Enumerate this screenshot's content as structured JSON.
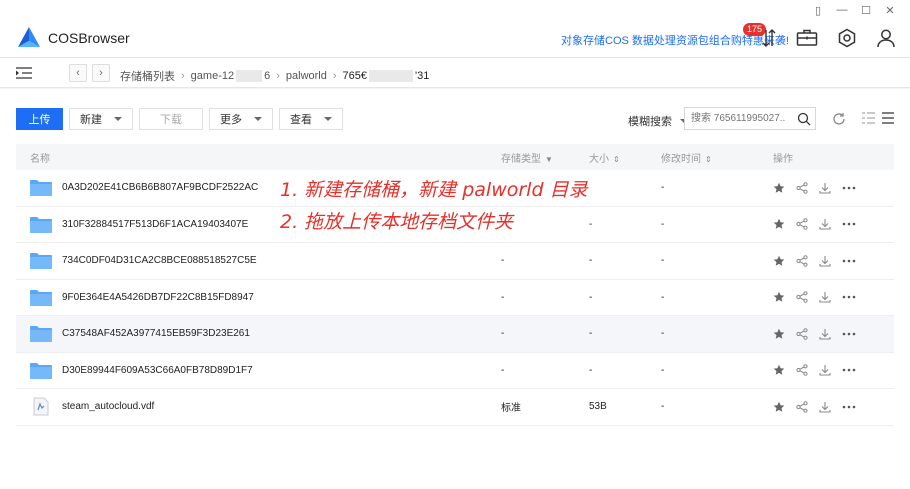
{
  "app": {
    "title": "COSBrowser"
  },
  "promo": {
    "text": "对象存储COS 数据处理资源包组合购特惠来袭!",
    "badge": "175"
  },
  "window_controls": [
    "▯",
    "—",
    "☐",
    "✕"
  ],
  "breadcrumb": {
    "root": "存储桶列表",
    "bucket": "game-12",
    "bucket_tail": "6",
    "folder": "palworld",
    "current": "765€",
    "current_tail": "'31"
  },
  "toolbar": {
    "upload": "上传",
    "new": "新建",
    "download": "下载",
    "more": "更多",
    "view": "查看"
  },
  "search": {
    "mode": "模糊搜索",
    "placeholder": "搜索 765611995027..."
  },
  "columns": {
    "name": "名称",
    "type": "存储类型",
    "size": "大小",
    "modified": "修改时间",
    "ops": "操作"
  },
  "rows": [
    {
      "name": "0A3D202E41CB6B6B807AF9BCDF2522AC",
      "type": "",
      "size": "",
      "modified": "-",
      "kind": "folder"
    },
    {
      "name": "310F32884517F513D6F1ACA19403407E",
      "type": "",
      "size": "-",
      "modified": "-",
      "kind": "folder"
    },
    {
      "name": "734C0DF04D31CA2C8BCE088518527C5E",
      "type": "-",
      "size": "-",
      "modified": "-",
      "kind": "folder"
    },
    {
      "name": "9F0E364E4A5426DB7DF22C8B15FD8947",
      "type": "-",
      "size": "-",
      "modified": "-",
      "kind": "folder"
    },
    {
      "name": "C37548AF452A3977415EB59F3D23E261",
      "type": "-",
      "size": "-",
      "modified": "-",
      "kind": "folder"
    },
    {
      "name": "D30E89944F609A53C66A0FB78D89D1F7",
      "type": "-",
      "size": "-",
      "modified": "-",
      "kind": "folder"
    },
    {
      "name": "steam_autocloud.vdf",
      "type": "标准",
      "size": "53B",
      "modified": "-",
      "kind": "file"
    }
  ],
  "annotations": {
    "line1": "1. 新建存储桶，新建 palworld 目录",
    "line2": "2. 拖放上传本地存档文件夹"
  },
  "colors": {
    "accent": "#1e6ef5",
    "annotation": "#e8302a",
    "badge": "#e8312f"
  }
}
